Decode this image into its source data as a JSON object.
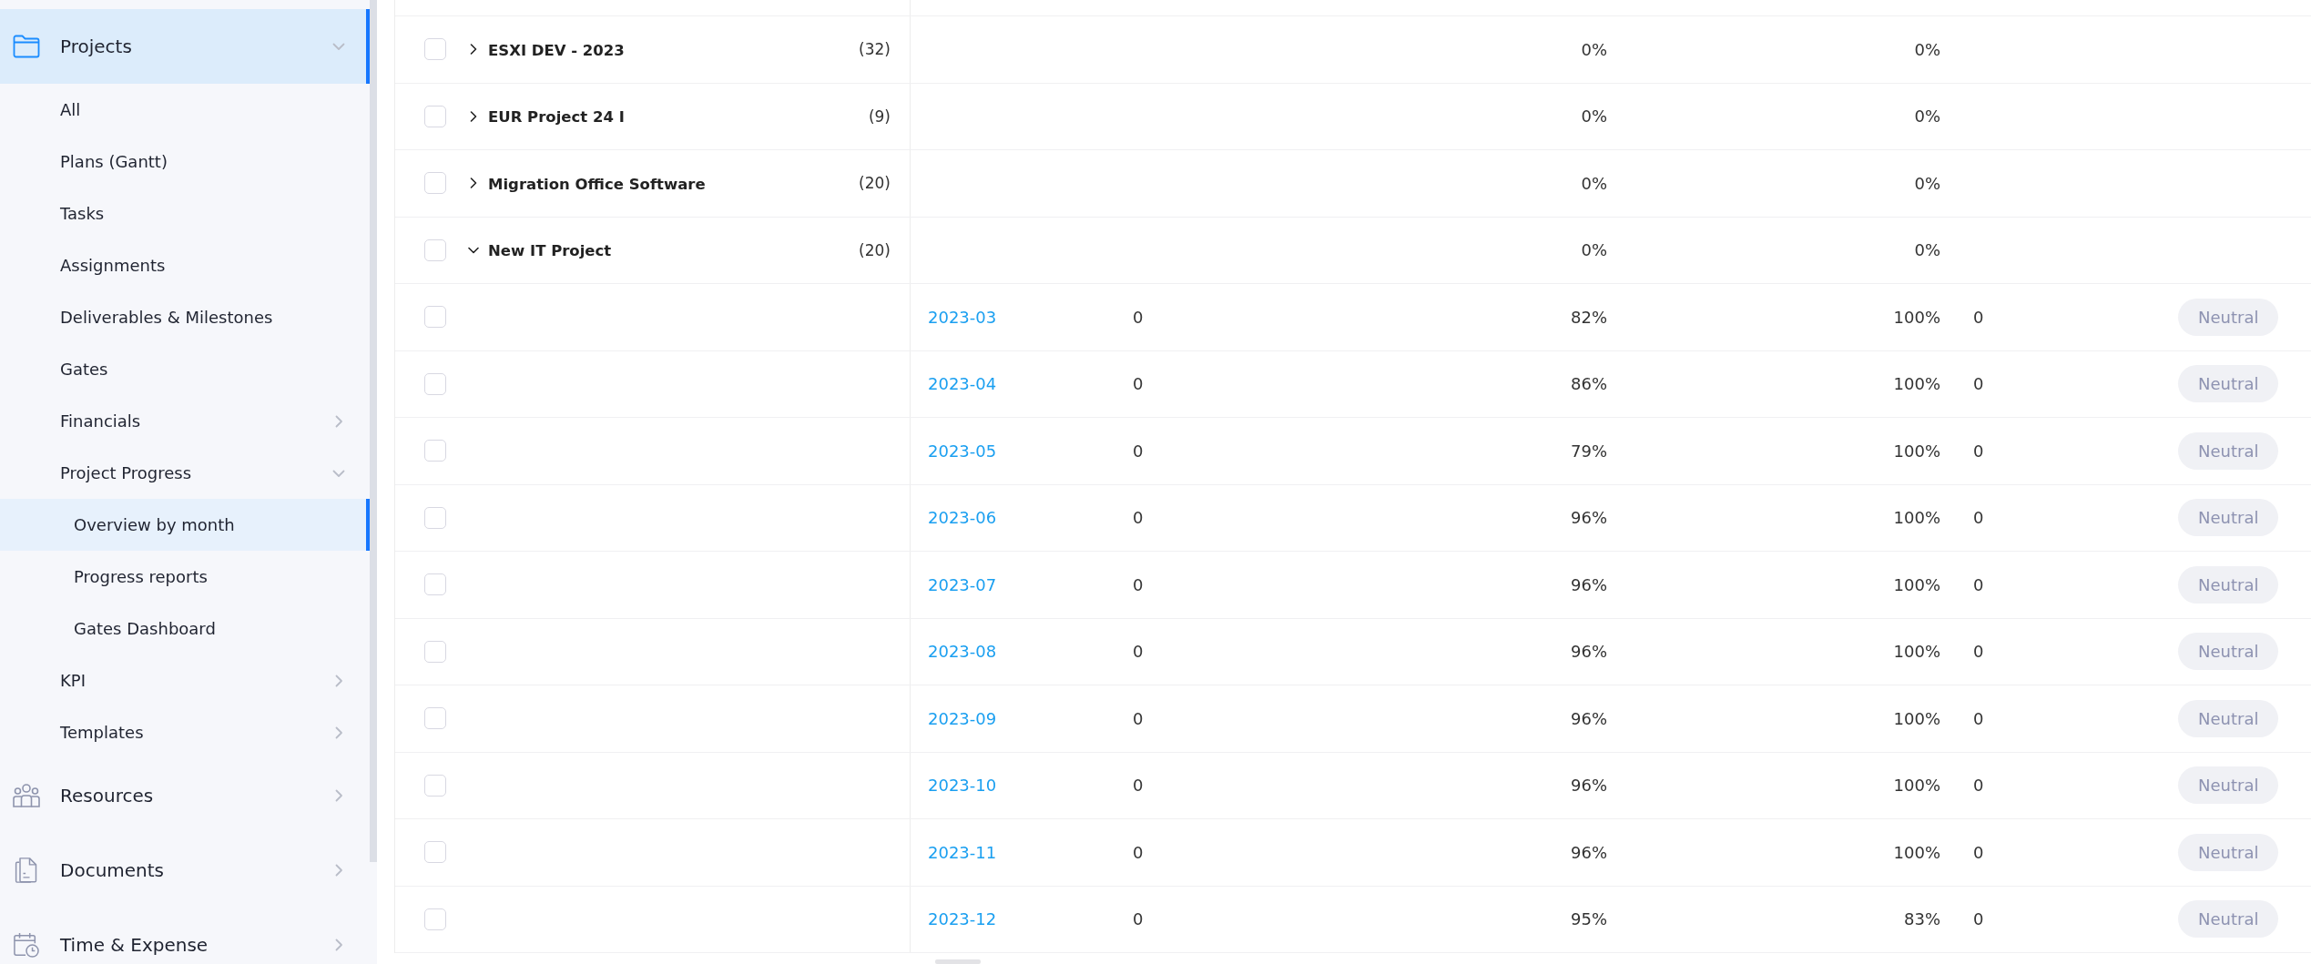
{
  "sidebar": {
    "items": [
      {
        "label": "Projects",
        "selected": true,
        "expanded": true,
        "children": [
          {
            "label": "All",
            "selected": false
          },
          {
            "label": "Plans (Gantt)",
            "selected": false
          },
          {
            "label": "Tasks",
            "selected": false
          },
          {
            "label": "Assignments",
            "selected": false
          },
          {
            "label": "Deliverables & Milestones",
            "selected": false
          },
          {
            "label": "Gates",
            "selected": false
          },
          {
            "label": "Financials",
            "selected": false,
            "expanded": false
          },
          {
            "label": "Project Progress",
            "selected": false,
            "expanded": true,
            "children": [
              {
                "label": "Overview by month",
                "selected": true
              },
              {
                "label": "Progress reports",
                "selected": false
              },
              {
                "label": "Gates Dashboard",
                "selected": false
              }
            ]
          },
          {
            "label": "KPI",
            "selected": false,
            "expanded": false
          },
          {
            "label": "Templates",
            "selected": false,
            "expanded": false
          }
        ]
      },
      {
        "label": "Resources",
        "selected": false,
        "expanded": false
      },
      {
        "label": "Documents",
        "selected": false,
        "expanded": false
      },
      {
        "label": "Time & Expense",
        "selected": false,
        "expanded": false
      }
    ]
  },
  "table": {
    "rows": [
      {
        "checked": false,
        "expanded": false,
        "name": "ESXI DEV - 2023",
        "count": "(32)",
        "column_4": "0%",
        "column_5": "0%"
      },
      {
        "checked": false,
        "expanded": false,
        "name": "EUR Project 24 I",
        "count": "(9)",
        "column_4": "0%",
        "column_5": "0%"
      },
      {
        "checked": false,
        "expanded": false,
        "name": "Migration Office Software",
        "count": "(20)",
        "column_4": "0%",
        "column_5": "0%"
      },
      {
        "checked": false,
        "expanded": true,
        "name": "New IT Project",
        "count": "(20)",
        "column_4": "0%",
        "column_5": "0%",
        "children": [
          {
            "checked": false,
            "column_2": "2023-03",
            "column_3": "0",
            "column_4": "82%",
            "column_5": "100%",
            "column_6": "0",
            "column_7": "Neutral"
          },
          {
            "checked": false,
            "column_2": "2023-04",
            "column_3": "0",
            "column_4": "86%",
            "column_5": "100%",
            "column_6": "0",
            "column_7": "Neutral"
          },
          {
            "checked": false,
            "column_2": "2023-05",
            "column_3": "0",
            "column_4": "79%",
            "column_5": "100%",
            "column_6": "0",
            "column_7": "Neutral"
          },
          {
            "checked": false,
            "column_2": "2023-06",
            "column_3": "0",
            "column_4": "96%",
            "column_5": "100%",
            "column_6": "0",
            "column_7": "Neutral"
          },
          {
            "checked": false,
            "column_2": "2023-07",
            "column_3": "0",
            "column_4": "96%",
            "column_5": "100%",
            "column_6": "0",
            "column_7": "Neutral"
          },
          {
            "checked": false,
            "column_2": "2023-08",
            "column_3": "0",
            "column_4": "96%",
            "column_5": "100%",
            "column_6": "0",
            "column_7": "Neutral"
          },
          {
            "checked": false,
            "column_2": "2023-09",
            "column_3": "0",
            "column_4": "96%",
            "column_5": "100%",
            "column_6": "0",
            "column_7": "Neutral"
          },
          {
            "checked": false,
            "column_2": "2023-10",
            "column_3": "0",
            "column_4": "96%",
            "column_5": "100%",
            "column_6": "0",
            "column_7": "Neutral"
          },
          {
            "checked": false,
            "column_2": "2023-11",
            "column_3": "0",
            "column_4": "96%",
            "column_5": "100%",
            "column_6": "0",
            "column_7": "Neutral"
          },
          {
            "checked": false,
            "column_2": "2023-12",
            "column_3": "0",
            "column_4": "95%",
            "column_5": "83%",
            "column_6": "0",
            "column_7": "Neutral"
          }
        ]
      }
    ]
  }
}
